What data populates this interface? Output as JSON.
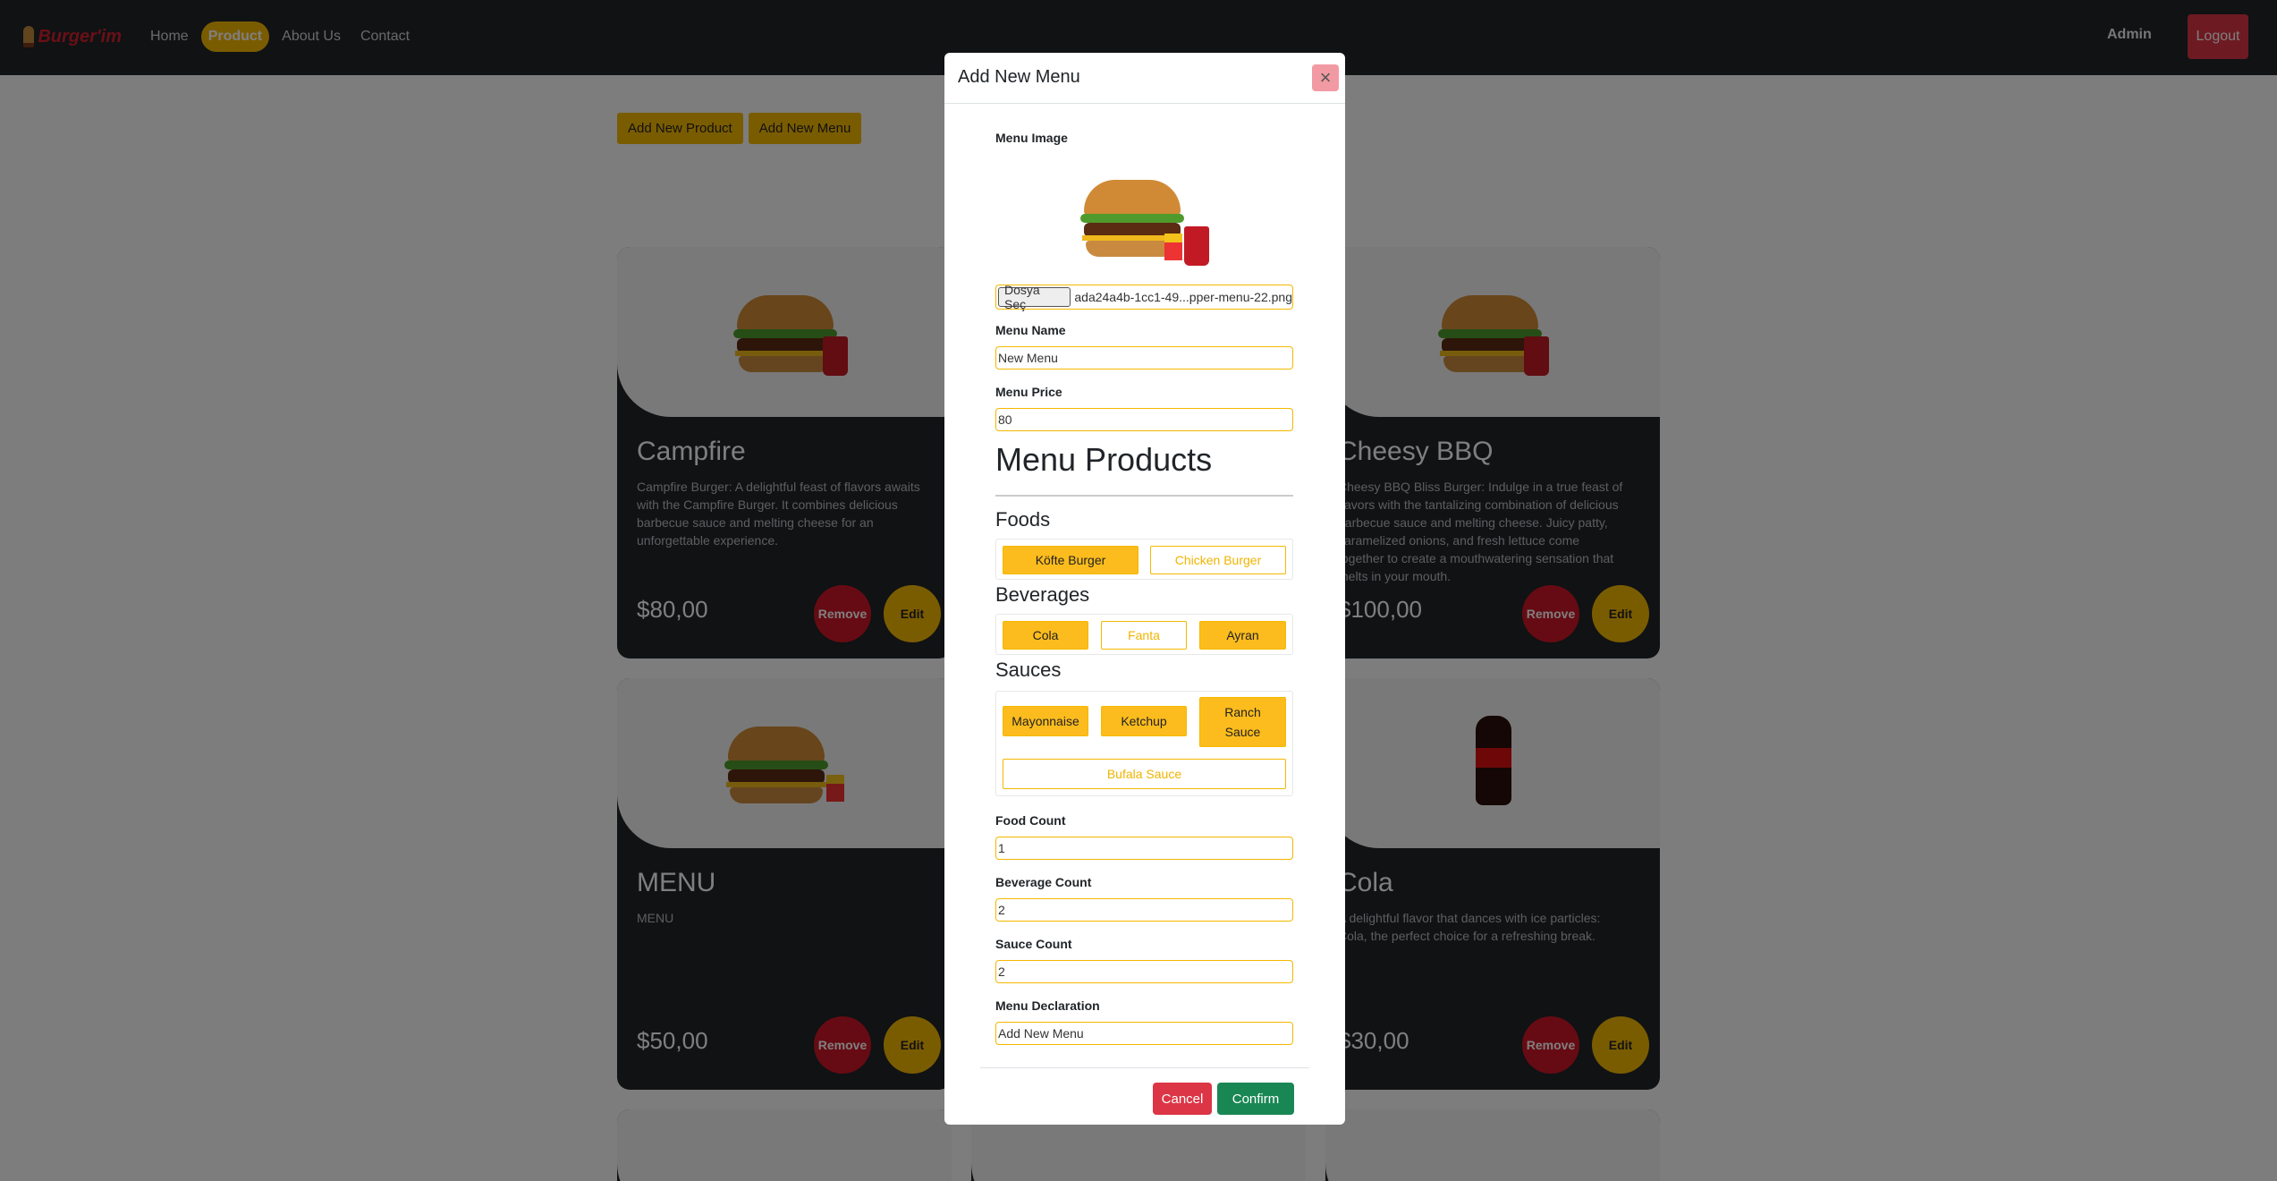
{
  "brand": {
    "name": "Burger'im"
  },
  "nav": {
    "links": [
      {
        "label": "Home"
      },
      {
        "label": "Product"
      },
      {
        "label": "About Us"
      },
      {
        "label": "Contact"
      }
    ],
    "admin_label": "Admin",
    "logout_label": "Logout"
  },
  "actions": {
    "add_product": "Add New Product",
    "add_menu": "Add New Menu"
  },
  "cards": [
    {
      "title": "Campfire",
      "description": "Campfire Burger: A delightful feast of flavors awaits with the Campfire Burger. It combines delicious barbecue sauce and melting cheese for an unforgettable experience.",
      "price": "$80,00",
      "remove": "Remove",
      "edit": "Edit"
    },
    {
      "title": "Cheesy BBQ",
      "description": "Cheesy BBQ Bliss Burger: Indulge in a true feast of flavors with the tantalizing combination of delicious barbecue sauce and melting cheese. Juicy patty, caramelized onions, and fresh lettuce come together to create a mouthwatering sensation that melts in your mouth.",
      "price": "$100,00",
      "remove": "Remove",
      "edit": "Edit"
    },
    {
      "title": "MENU",
      "description": "MENU",
      "price": "$50,00",
      "remove": "Remove",
      "edit": "Edit"
    },
    {
      "title": "Cola",
      "description": "A delightful flavor that dances with ice particles: Cola, the perfect choice for a refreshing break.",
      "price": "$30,00",
      "remove": "Remove",
      "edit": "Edit"
    }
  ],
  "modal": {
    "title": "Add New Menu",
    "close_icon": "close-icon",
    "image_label": "Menu Image",
    "file_button": "Dosya Seç",
    "file_name": "ada24a4b-1cc1-49...pper-menu-22.png",
    "name_label": "Menu Name",
    "name_value": "New Menu",
    "price_label": "Menu Price",
    "price_value": "80",
    "products_title": "Menu Products",
    "foods_title": "Foods",
    "foods": [
      {
        "label": "Köfte Burger",
        "selected": true
      },
      {
        "label": "Chicken Burger",
        "selected": false
      }
    ],
    "beverages_title": "Beverages",
    "beverages": [
      {
        "label": "Cola",
        "selected": true
      },
      {
        "label": "Fanta",
        "selected": false
      },
      {
        "label": "Ayran",
        "selected": true
      }
    ],
    "sauces_title": "Sauces",
    "sauces": [
      {
        "label": "Mayonnaise",
        "selected": true
      },
      {
        "label": "Ketchup",
        "selected": true
      },
      {
        "label": "Ranch Sauce",
        "selected": true
      },
      {
        "label": "Bufala Sauce",
        "selected": false
      }
    ],
    "food_count_label": "Food Count",
    "food_count_value": "1",
    "beverage_count_label": "Beverage Count",
    "beverage_count_value": "2",
    "sauce_count_label": "Sauce Count",
    "sauce_count_value": "2",
    "declaration_label": "Menu Declaration",
    "declaration_value": "Add New Menu",
    "cancel_label": "Cancel",
    "confirm_label": "Confirm"
  },
  "colors": {
    "accent": "#f5b800",
    "danger": "#dc3545",
    "success": "#198754",
    "navbar": "#212529"
  }
}
